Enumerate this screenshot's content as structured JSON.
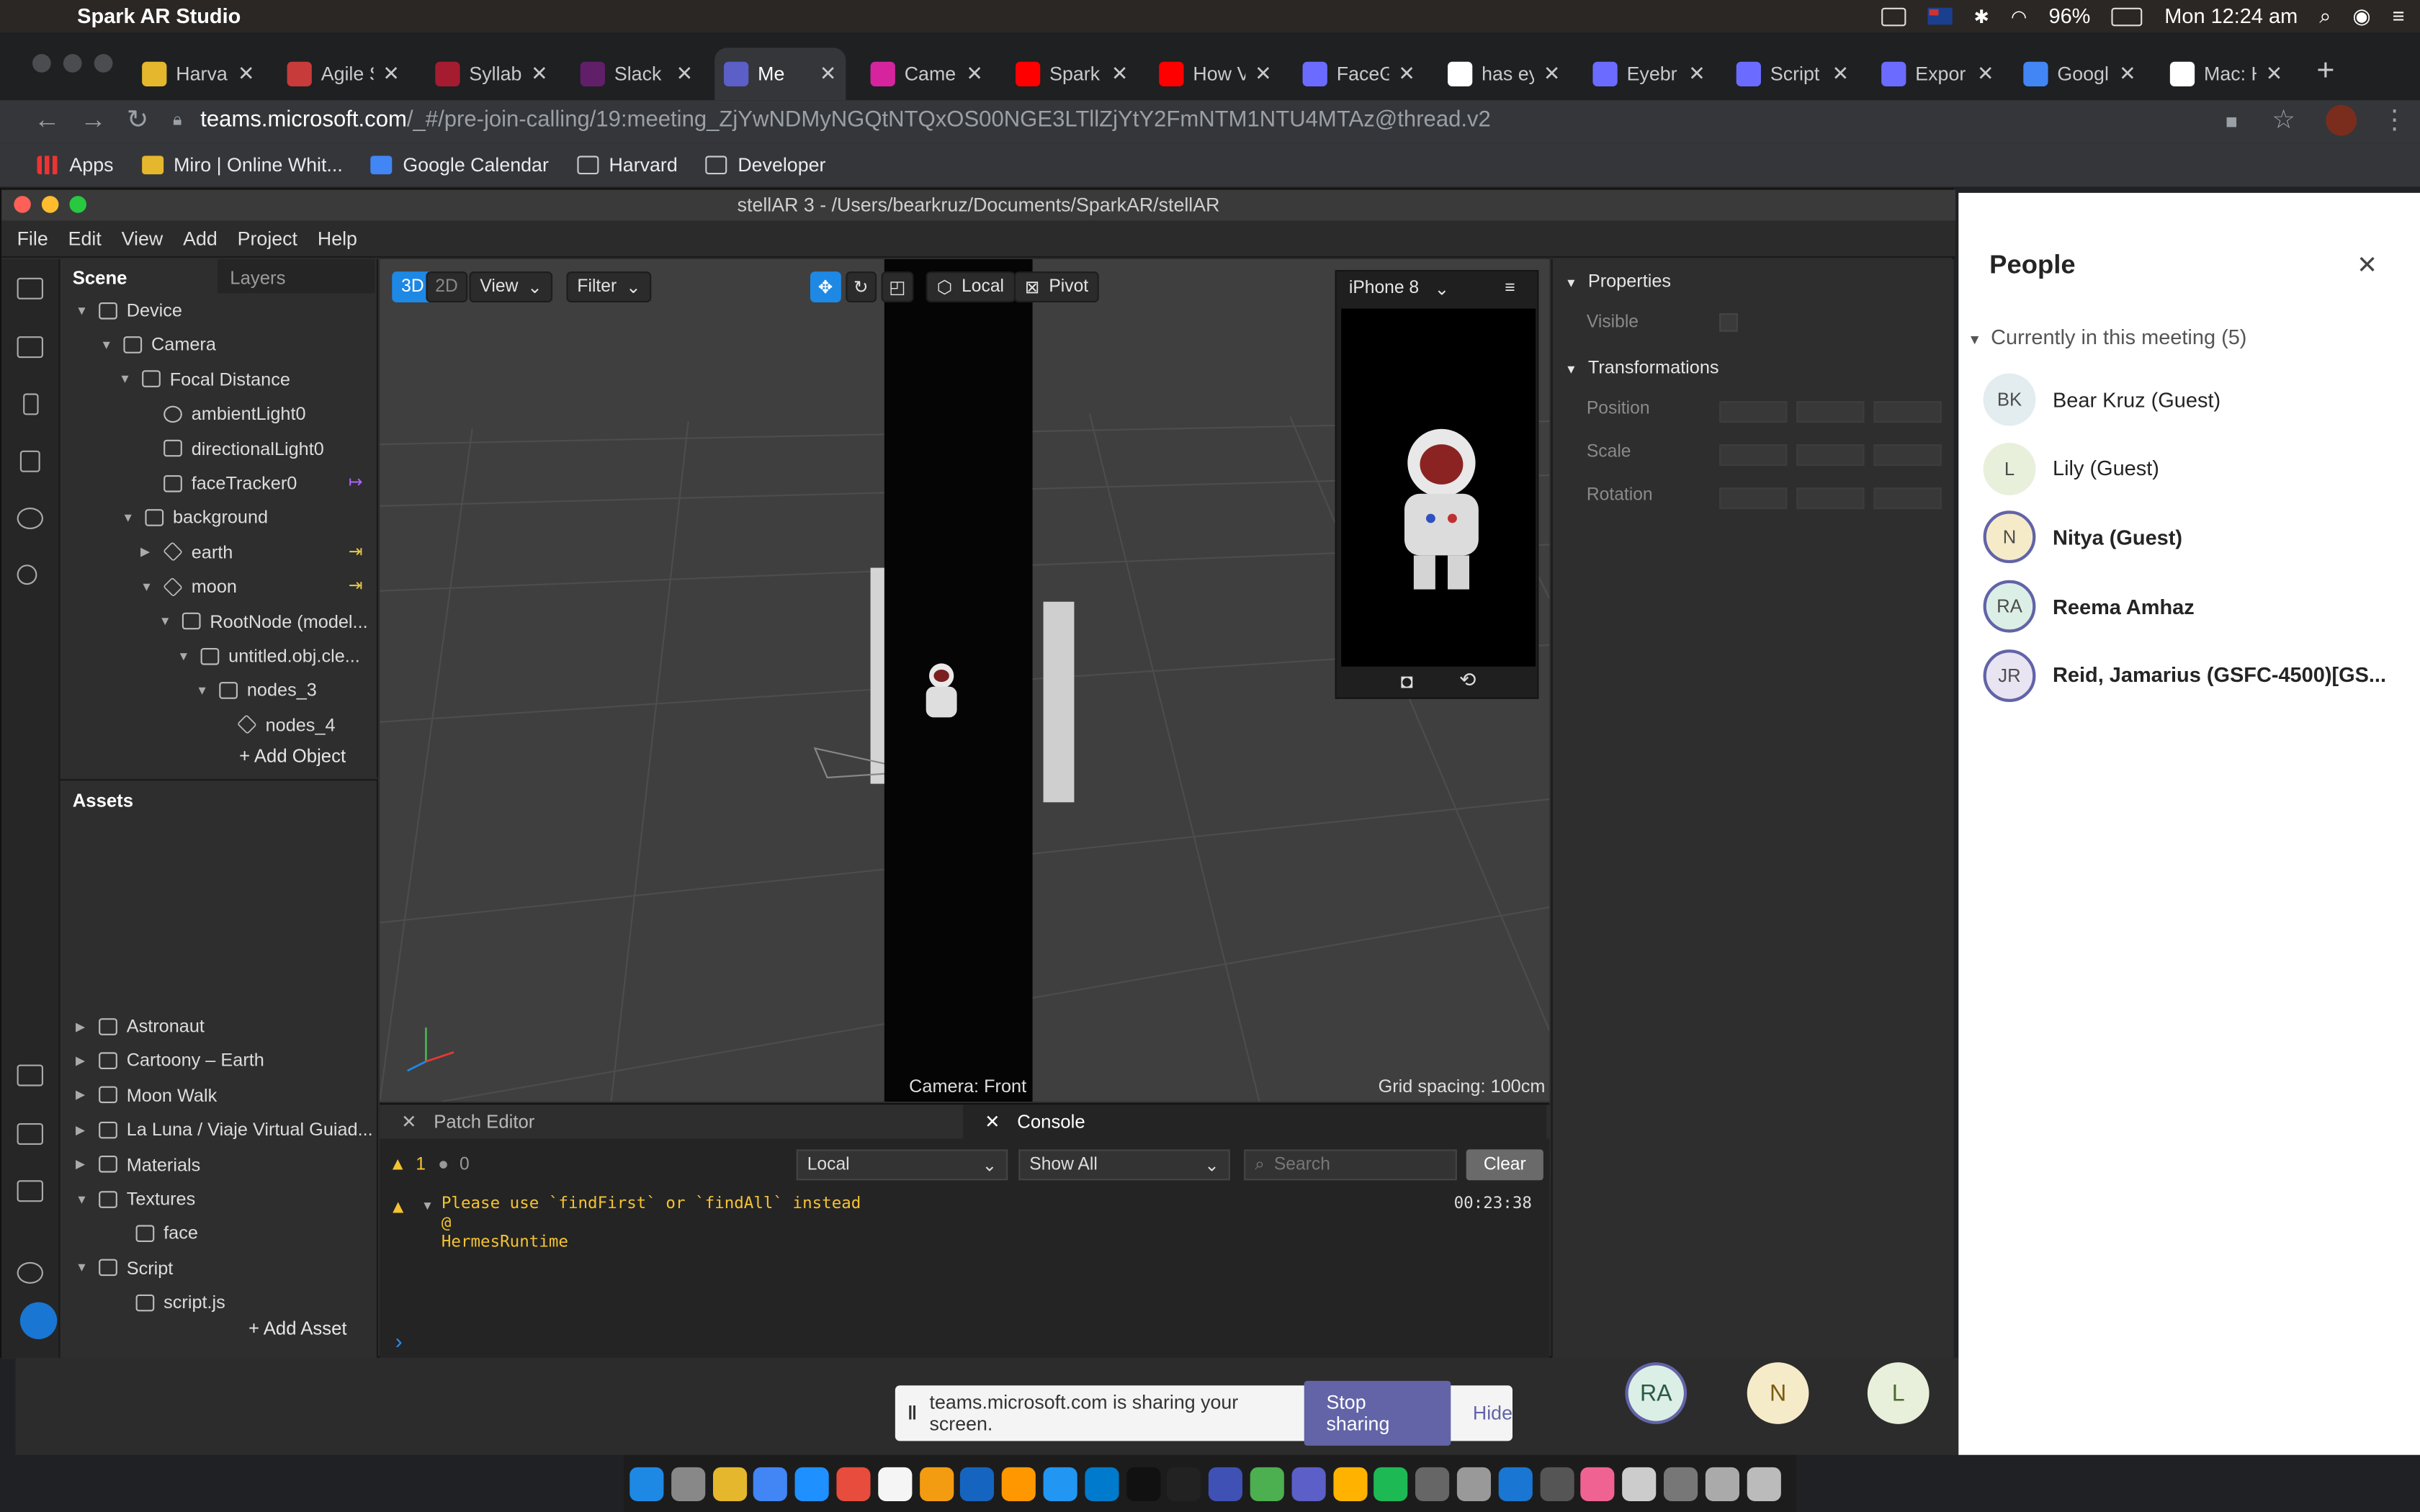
{
  "menubar": {
    "app_name": "Spark AR Studio",
    "battery": "96%",
    "clock": "Mon 12:24 am"
  },
  "chrome": {
    "tabs": [
      {
        "title": "Harvar",
        "icon_color": "#e5b72c",
        "icon": "miro-icon"
      },
      {
        "title": "Agile S",
        "icon_color": "#c73b3b",
        "icon": "agile-icon"
      },
      {
        "title": "Syllabi",
        "icon_color": "#a51c30",
        "icon": "harvard-icon"
      },
      {
        "title": "Slack",
        "icon_color": "#611f69",
        "icon": "slack-icon"
      },
      {
        "title": "Me",
        "icon_color": "#5b5fc7",
        "icon": "teams-icon",
        "active": true
      },
      {
        "title": "Camer",
        "icon_color": "#d6249f",
        "icon": "instagram-icon"
      },
      {
        "title": "Spark",
        "icon_color": "#ff0000",
        "icon": "youtube-icon"
      },
      {
        "title": "How V",
        "icon_color": "#ff0000",
        "icon": "youtube-icon"
      },
      {
        "title": "FaceG",
        "icon_color": "#6b6bff",
        "icon": "spark-icon"
      },
      {
        "title": "has ey",
        "icon_color": "#ffffff",
        "icon": "google-icon"
      },
      {
        "title": "Eyebr",
        "icon_color": "#6b6bff",
        "icon": "spark-icon"
      },
      {
        "title": "Script",
        "icon_color": "#6b6bff",
        "icon": "spark-icon"
      },
      {
        "title": "Expor",
        "icon_color": "#6b6bff",
        "icon": "spark-icon"
      },
      {
        "title": "Googl",
        "icon_color": "#4285f4",
        "icon": "calendar-icon"
      },
      {
        "title": "Mac: H",
        "icon_color": "#ffffff",
        "icon": "clock-icon"
      }
    ],
    "url_host": "teams.microsoft.com",
    "url_path": "/_#/pre-join-calling/19:meeting_ZjYwNDMyNGQtNTQxOS00NGE3LTllZjYtY2FmNTM1NTU4MTAz@thread.v2",
    "bookmarks": [
      "Apps",
      "Miro | Online Whit...",
      "Google Calendar",
      "Harvard",
      "Developer"
    ]
  },
  "spark": {
    "window_title": "stellAR 3 - /Users/bearkruz/Documents/SparkAR/stellAR",
    "menu": [
      "File",
      "Edit",
      "View",
      "Add",
      "Project",
      "Help"
    ],
    "scene_tab": "Scene",
    "layers_tab": "Layers",
    "tree": [
      "Device",
      "Camera",
      "Focal Distance",
      "ambientLight0",
      "directionalLight0",
      "faceTracker0",
      "background",
      "earth",
      "moon",
      "RootNode (model...",
      "untitled.obj.cle...",
      "nodes_3",
      "nodes_4"
    ],
    "add_object": "+ Add Object",
    "assets_title": "Assets",
    "assets": [
      "Astronaut",
      "Cartoony – Earth",
      "Moon Walk",
      "La Luna / Viaje Virtual Guiad...",
      "Materials",
      "Textures",
      "face",
      "Script",
      "script.js"
    ],
    "add_asset": "+ Add Asset",
    "viewport": {
      "btn_3d": "3D",
      "btn_2d": "2D",
      "view": "View",
      "filter": "Filter",
      "local": "Local",
      "pivot": "Pivot",
      "device": "iPhone 8",
      "camera_label": "Camera: Front",
      "grid_label": "Grid spacing: 100cm"
    },
    "bottom": {
      "patch_editor": "Patch Editor",
      "console": "Console",
      "warn_count": "1",
      "err_count": "0",
      "scope": "Local",
      "filter": "Show All",
      "search_placeholder": "Search",
      "clear": "Clear",
      "log_line1": "Please use `findFirst` or `findAll` instead",
      "log_line2": "@",
      "log_line3": "HermesRuntime",
      "log_time": "00:23:38"
    },
    "props": {
      "properties": "Properties",
      "visible": "Visible",
      "transformations": "Transformations",
      "position": "Position",
      "scale": "Scale",
      "rotation": "Rotation"
    }
  },
  "people": {
    "title": "People",
    "section": "Currently in this meeting (5)",
    "members": [
      {
        "initials": "BK",
        "name": "Bear Kruz (Guest)",
        "bold": false,
        "color": "#e3ecef"
      },
      {
        "initials": "L",
        "name": "Lily (Guest)",
        "bold": false,
        "color": "#e8f0dc"
      },
      {
        "initials": "N",
        "name": "Nitya (Guest)",
        "bold": true,
        "color": "#f6ebc9"
      },
      {
        "initials": "RA",
        "name": "Reema Amhaz",
        "bold": true,
        "color": "#dcefe6"
      },
      {
        "initials": "JR",
        "name": "Reid, Jamarius (GSFC-4500)[GS...",
        "bold": true,
        "color": "#e9e4f2"
      }
    ]
  },
  "stage": {
    "avatars": [
      "RA",
      "N",
      "L"
    ],
    "share_text": "teams.microsoft.com is sharing your screen.",
    "stop_sharing": "Stop sharing",
    "hide": "Hide"
  }
}
